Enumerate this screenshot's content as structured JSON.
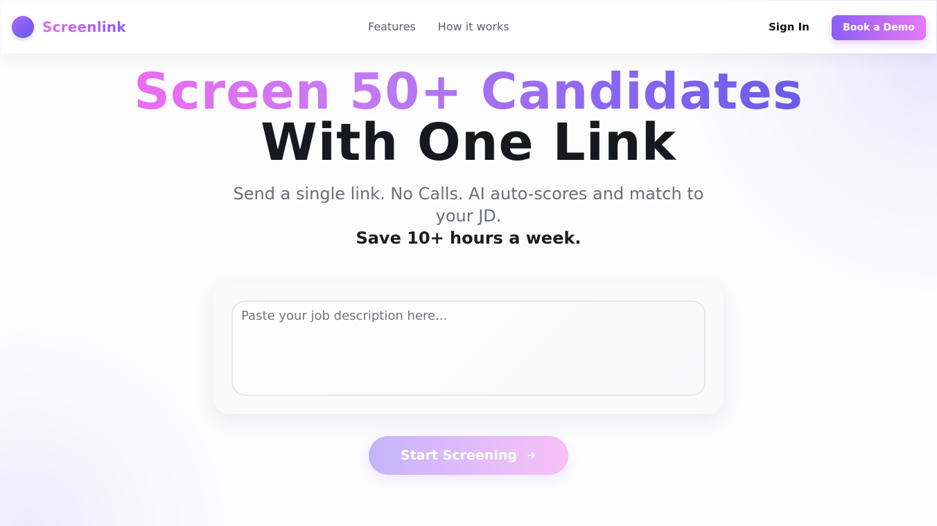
{
  "header": {
    "brand_name": "Screenlink",
    "nav": [
      {
        "label": "Features"
      },
      {
        "label": "How it works"
      }
    ],
    "sign_in_label": "Sign In",
    "demo_label": "Book a Demo"
  },
  "hero": {
    "title_highlight": "Screen 50+ Candidates",
    "title_main": "With One Link",
    "subtitle": "Send a single link. No Calls. AI auto-scores and match to your JD.",
    "subtitle_strong": "Save 10+ hours a week."
  },
  "form": {
    "jd_placeholder": "Paste your job description here...",
    "jd_value": "",
    "submit_label": "Start Screening",
    "submit_icon": "arrow-right-icon"
  },
  "colors": {
    "accent_start": "#8b5cf6",
    "accent_end": "#e879f9"
  }
}
